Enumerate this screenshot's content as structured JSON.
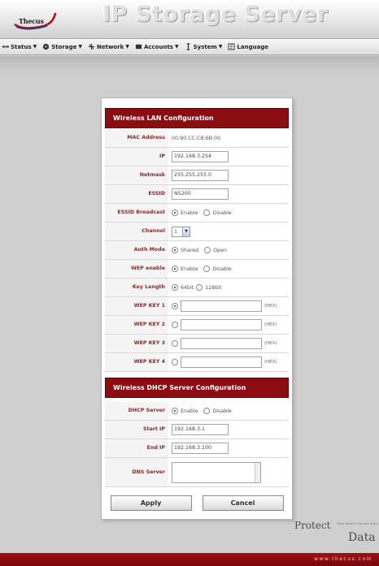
{
  "header": {
    "logo_text": "Thecus",
    "title": "IP Storage Server"
  },
  "nav": {
    "items": [
      {
        "label": "Status",
        "icon": "status-icon"
      },
      {
        "label": "Storage",
        "icon": "storage-icon"
      },
      {
        "label": "Network",
        "icon": "network-icon"
      },
      {
        "label": "Accounts",
        "icon": "accounts-icon"
      },
      {
        "label": "System",
        "icon": "system-icon"
      },
      {
        "label": "Language",
        "icon": "language-icon"
      }
    ]
  },
  "wlan": {
    "heading": "Wireless LAN Configuration",
    "mac_label": "MAC Address",
    "mac_value": "00:90:CC:C8:6B:00",
    "ip_label": "IP",
    "ip_value": "192.168.3.254",
    "netmask_label": "Netmask",
    "netmask_value": "255.255.255.0",
    "essid_label": "ESSID",
    "essid_value": "N5200",
    "essid_broadcast_label": "ESSID Broadcast",
    "essid_broadcast_options": [
      "Enable",
      "Disable"
    ],
    "essid_broadcast_selected": "Enable",
    "channel_label": "Channel",
    "channel_value": "1",
    "auth_label": "Auth Mode",
    "auth_options": [
      "Shared",
      "Open"
    ],
    "auth_selected": "Shared",
    "wep_enable_label": "WEP enable",
    "wep_enable_options": [
      "Enable",
      "Disable"
    ],
    "wep_enable_selected": "Enable",
    "key_length_label": "Key Length",
    "key_length_options": [
      "64bit",
      "128bit"
    ],
    "key_length_selected": "64bit",
    "wep_keys": [
      {
        "label": "WEP KEY 1",
        "value": "",
        "selected": true,
        "suffix": "(HEX)"
      },
      {
        "label": "WEP KEY 2",
        "value": "",
        "selected": false,
        "suffix": "(HEX)"
      },
      {
        "label": "WEP KEY 3",
        "value": "",
        "selected": false,
        "suffix": "(HEX)"
      },
      {
        "label": "WEP KEY 4",
        "value": "",
        "selected": false,
        "suffix": "(HEX)"
      }
    ]
  },
  "dhcp": {
    "heading": "Wireless DHCP Server Configuration",
    "server_label": "DHCP Server",
    "server_options": [
      "Enable",
      "Disable"
    ],
    "server_selected": "Enable",
    "start_ip_label": "Start IP",
    "start_ip_value": "192.168.3.1",
    "end_ip_label": "End IP",
    "end_ip_value": "192.168.3.100",
    "dns_label": "DNS Server",
    "dns_value": ""
  },
  "buttons": {
    "apply": "Apply",
    "cancel": "Cancel"
  },
  "slogan": {
    "word1": "Protect",
    "small": "Your Source Secure Your",
    "word2": "Data"
  },
  "footer": {
    "url": "www.thecus.com"
  },
  "colors": {
    "accent": "#8b0d12",
    "label_text": "#8b2a2a",
    "background": "#cfcfcf"
  }
}
